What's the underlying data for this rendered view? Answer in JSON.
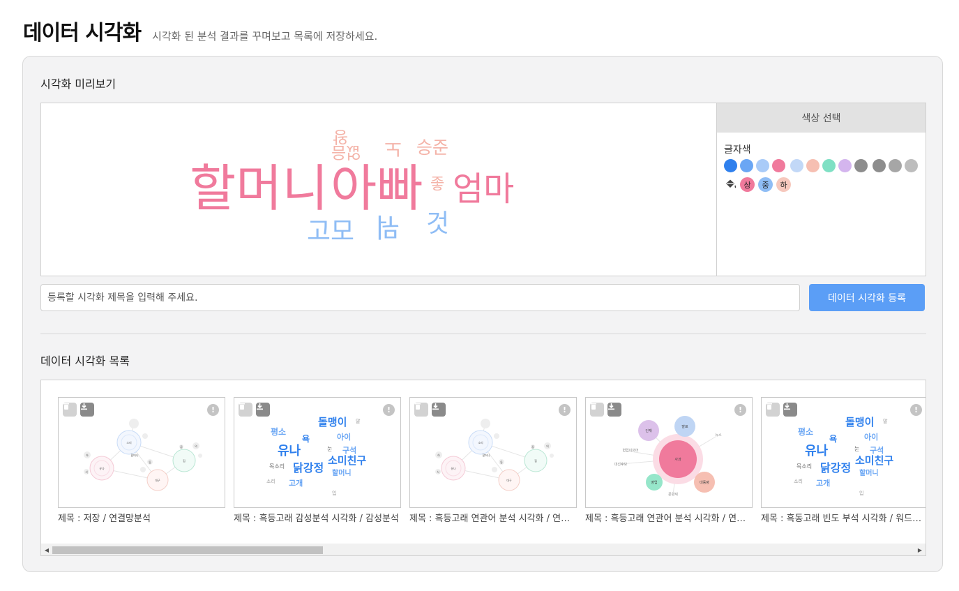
{
  "header": {
    "title": "데이터 시각화",
    "subtitle": "시각화 된 분석 결과를 꾸며보고 목록에 저장하세요."
  },
  "preview": {
    "section_label": "시각화 미리보기",
    "words": [
      {
        "text": "할머니",
        "color": "#f07a9c"
      },
      {
        "text": "아빠",
        "color": "#f07a9c"
      },
      {
        "text": "엄마",
        "color": "#f07a9c"
      },
      {
        "text": "승준",
        "color": "#f4b3a8"
      },
      {
        "text": "노",
        "color": "#f4b3a8"
      },
      {
        "text": "왕",
        "color": "#f4b3a8"
      },
      {
        "text": "없음",
        "color": "#f4b3a8"
      },
      {
        "text": "좋",
        "color": "#f4b3a8"
      },
      {
        "text": "고모",
        "color": "#8fbdf5"
      },
      {
        "text": "뭐",
        "color": "#8fbdf5"
      },
      {
        "text": "것",
        "color": "#8fbdf5"
      }
    ]
  },
  "color_panel": {
    "header": "색상 선택",
    "text_color_label": "글자색",
    "swatches": [
      "#2f80ed",
      "#6aa6f4",
      "#a9cbf8",
      "#f07a9c",
      "#c2d8f7",
      "#f6bfb2",
      "#7fe0c4",
      "#d4b5ee",
      "#8d8d8d",
      "#8d8d8d",
      "#a6a6a6",
      "#bdbdbd"
    ],
    "size_buttons": [
      {
        "label": "상",
        "color": "#f07a9c"
      },
      {
        "label": "중",
        "color": "#8fbdf5"
      },
      {
        "label": "하",
        "color": "#f6c8bd"
      }
    ]
  },
  "form": {
    "title_placeholder": "등록할 시각화 제목을 입력해 주세요.",
    "register_label": "데이터 시각화 등록"
  },
  "list": {
    "section_label": "데이터 시각화 목록",
    "cards": [
      {
        "title": "제목 :   저장 / 연결망분석",
        "type": "network"
      },
      {
        "title": "제목 :   흑등고래 감성분석 시각화 / 감성분석",
        "type": "wordcloud"
      },
      {
        "title": "제목 :   흑등고래 연관어 분석 시각화 / 연결망분석",
        "type": "network"
      },
      {
        "title": "제목 :   흑등고래 연관어 분석 시각화 / 연관어분석",
        "type": "bubble"
      },
      {
        "title": "제목 :   흑동고래 빈도 부석 시각화 / 워드클라우드",
        "type": "wordcloud"
      }
    ],
    "info_glyph": "!"
  },
  "thumbnails": {
    "network_labels": [
      "소리",
      "할머니",
      "유나",
      "대구",
      "짐",
      "하",
      "식",
      "동",
      "꿈",
      "의"
    ],
    "wordcloud_words": [
      "돌맹이",
      "평소",
      "욕",
      "아이",
      "유나",
      "구석",
      "소미친구",
      "닭강정",
      "할머니",
      "목소리",
      "고개",
      "소리",
      "눈",
      "입",
      "말"
    ],
    "bubble_labels": [
      "사과",
      "인재",
      "발표",
      "영업",
      "대동령",
      "뉴스",
      "문양새",
      "협업이저어",
      "대선후보"
    ]
  }
}
